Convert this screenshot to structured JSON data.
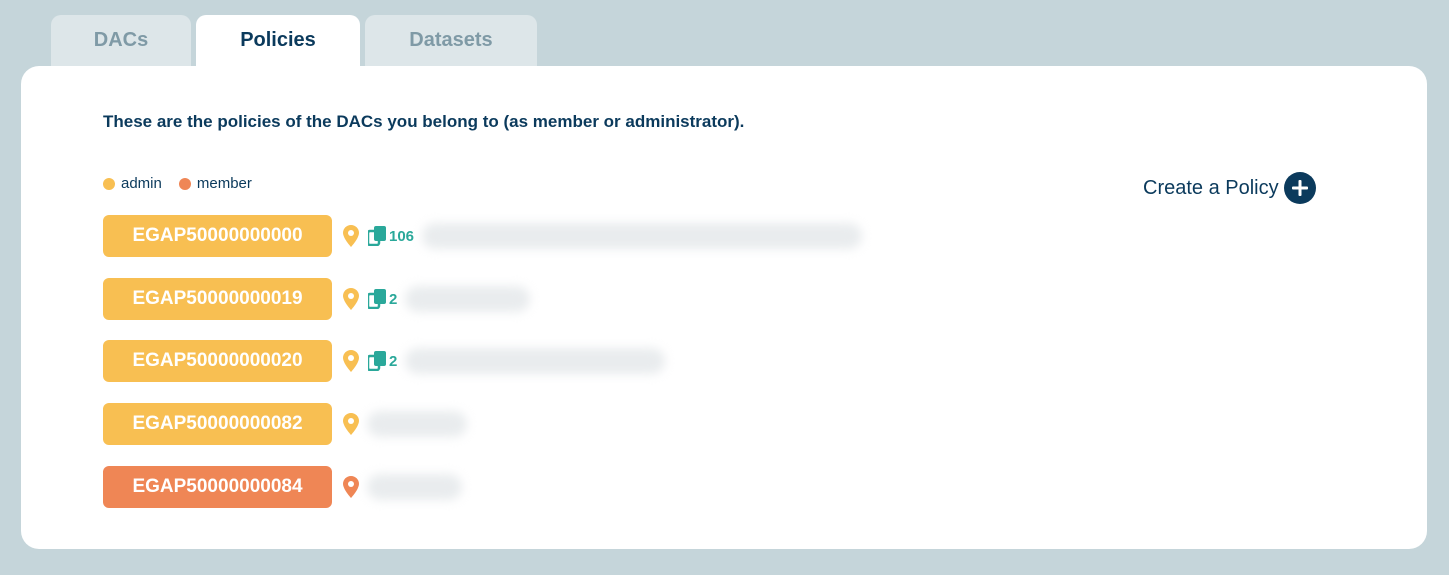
{
  "tabs": [
    {
      "label": "DACs",
      "active": false
    },
    {
      "label": "Policies",
      "active": true
    },
    {
      "label": "Datasets",
      "active": false
    }
  ],
  "intro": "These are the policies of the DACs you belong to (as member or administrator).",
  "legend": {
    "admin": {
      "label": "admin",
      "color": "#f8bf52"
    },
    "member": {
      "label": "member",
      "color": "#ef8655"
    }
  },
  "create_policy": {
    "label": "Create a Policy",
    "icon": "plus-circle-icon"
  },
  "policies": [
    {
      "id": "EGAP50000000000",
      "role": "admin",
      "dataset_count": "106",
      "description": "[redacted]"
    },
    {
      "id": "EGAP50000000019",
      "role": "admin",
      "dataset_count": "2",
      "description": "[redacted]"
    },
    {
      "id": "EGAP50000000020",
      "role": "admin",
      "dataset_count": "2",
      "description": "[redacted]"
    },
    {
      "id": "EGAP50000000082",
      "role": "admin",
      "dataset_count": "",
      "description": "[redacted]"
    },
    {
      "id": "EGAP50000000084",
      "role": "member",
      "dataset_count": "",
      "description": "[redacted]"
    }
  ],
  "colors": {
    "admin": "#f8bf52",
    "member": "#ef8655",
    "navy": "#0b3a5c",
    "teal": "#2aa89a",
    "background": "#c5d5da"
  }
}
